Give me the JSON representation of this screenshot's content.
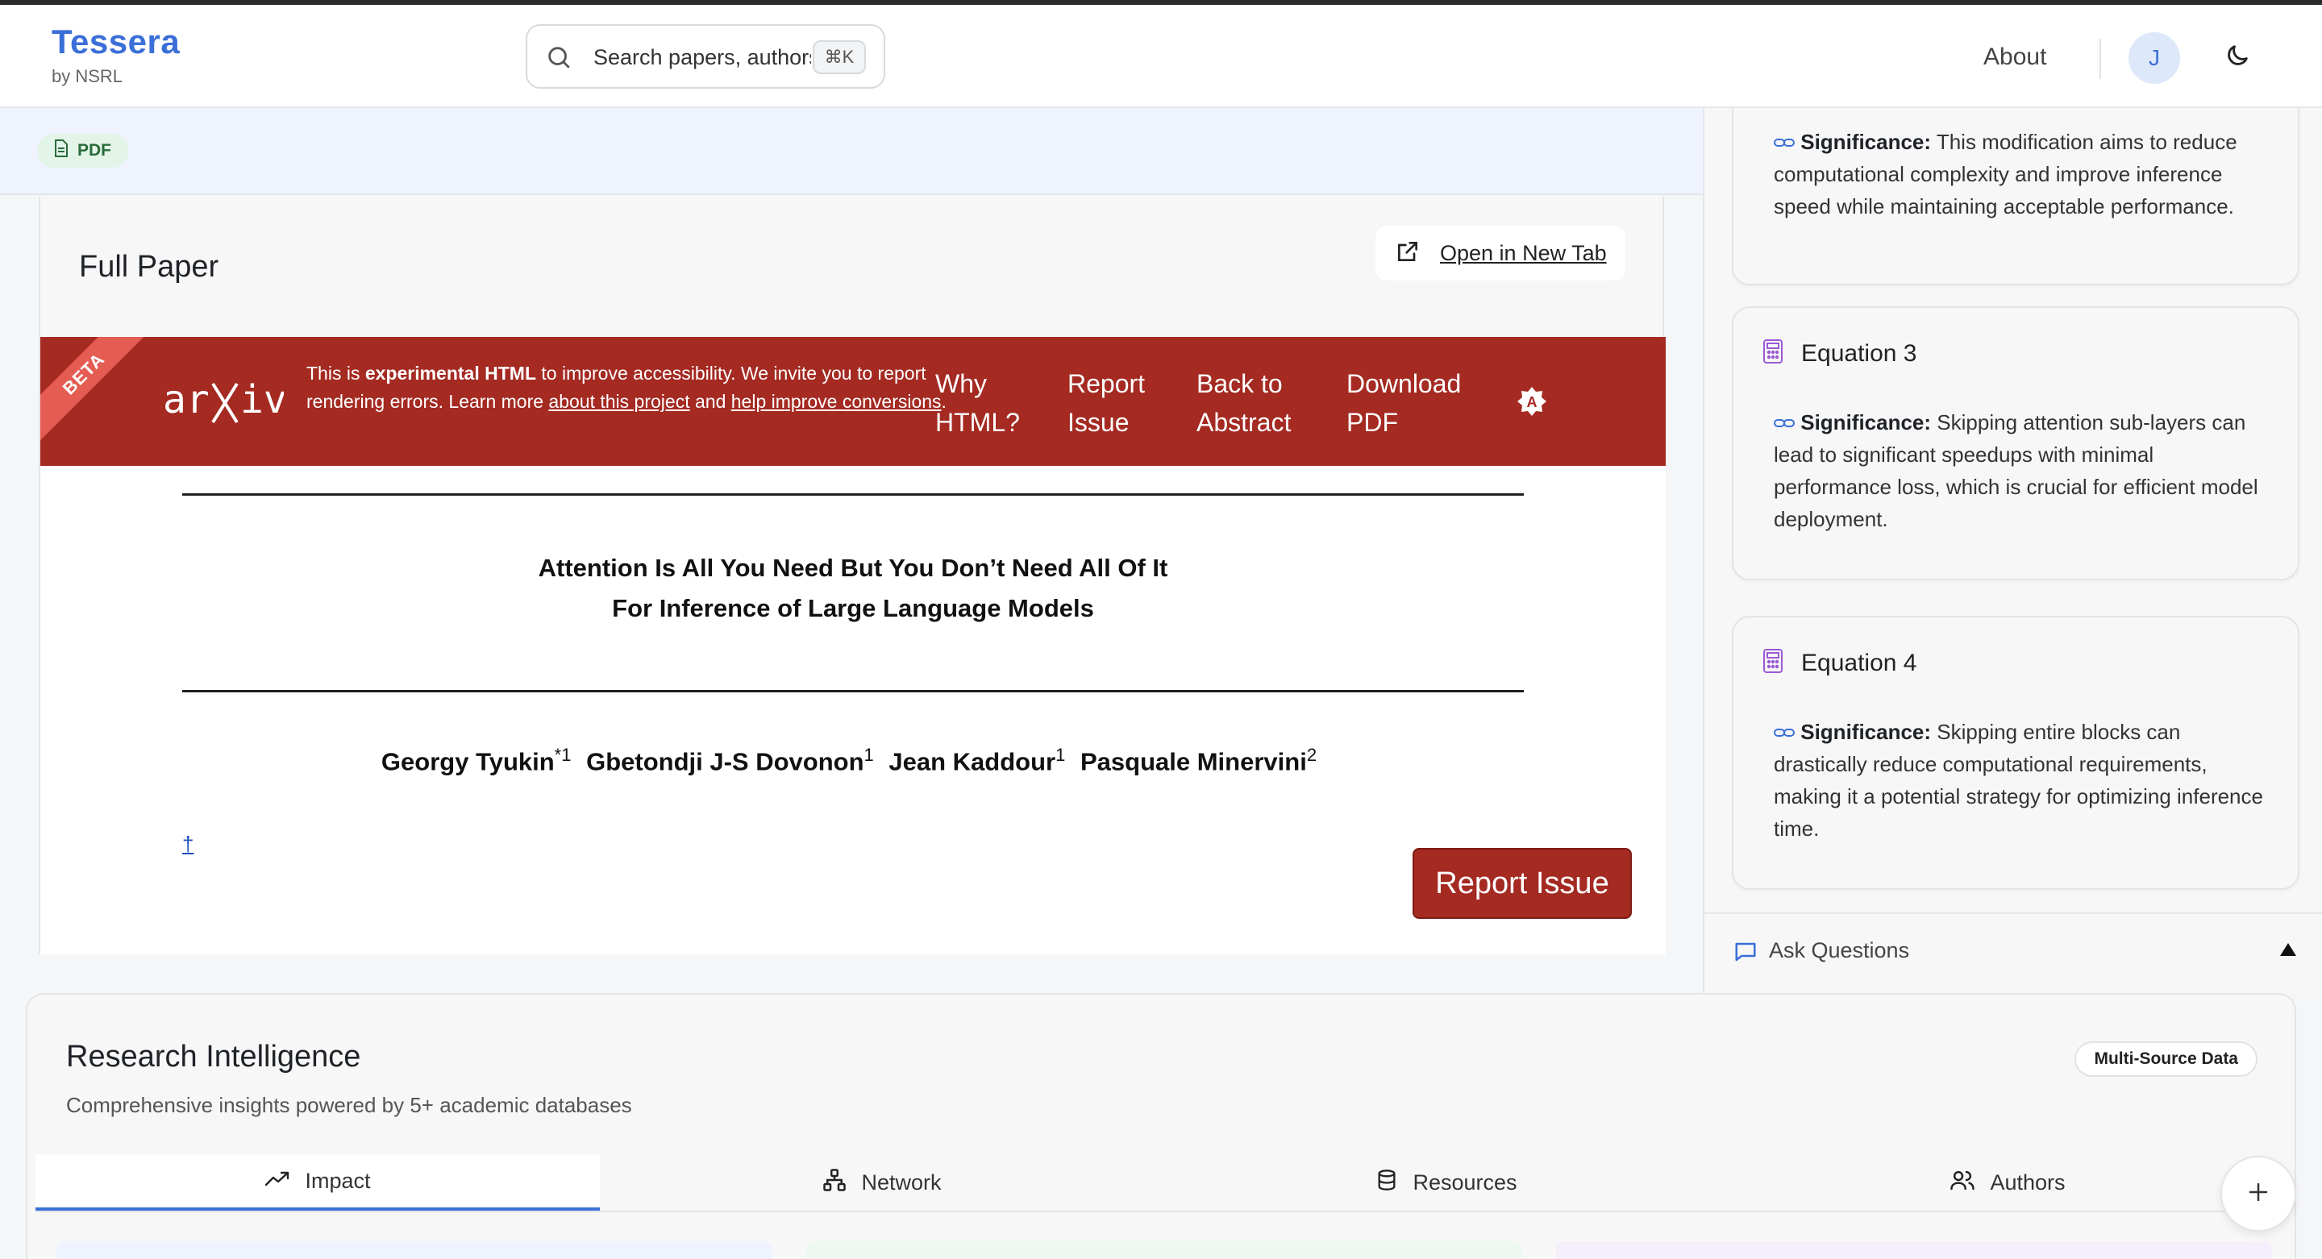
{
  "header": {
    "brand_title": "Tessera",
    "brand_sub": "by NSRL",
    "search_placeholder": "Search papers, authors...",
    "search_shortcut": "⌘K",
    "about_label": "About",
    "avatar_initial": "J"
  },
  "paper": {
    "format_badge": "PDF",
    "full_paper_title": "Full Paper",
    "open_new_tab_label": "Open in New Tab",
    "arxiv_banner": {
      "ribbon": "BETA",
      "logo_text": "arXiv",
      "notice_pre": "This is ",
      "notice_bold": "experimental HTML",
      "notice_mid": " to improve accessibility. We invite you to report rendering errors. Learn more ",
      "notice_link1": "about this project",
      "notice_and": " and ",
      "notice_link2": "help improve conversions",
      "notice_end": ".",
      "links": [
        "Why HTML?",
        "Report Issue",
        "Back to Abstract",
        "Download PDF"
      ]
    },
    "title_line1": "Attention Is All You Need But You Don’t Need All Of It",
    "title_line2": "For Inference of Large Language Models",
    "authors": [
      {
        "name": "Georgy Tyukin",
        "sup": "*1"
      },
      {
        "name": "Gbetondji J-S Dovonon",
        "sup": "1"
      },
      {
        "name": "Jean Kaddour",
        "sup": "1"
      },
      {
        "name": "Pasquale Minervini",
        "sup": "2"
      }
    ],
    "dagger": "†",
    "report_button": "Report Issue"
  },
  "equations": [
    {
      "title": "",
      "significance_label": "Significance:",
      "significance": "This modification aims to reduce computational complexity and improve inference speed while maintaining acceptable performance."
    },
    {
      "title": "Equation 3",
      "significance_label": "Significance:",
      "significance": "Skipping attention sub-layers can lead to significant speedups with minimal performance loss, which is crucial for efficient model deployment."
    },
    {
      "title": "Equation 4",
      "significance_label": "Significance:",
      "significance": "Skipping entire blocks can drastically reduce computational requirements, making it a potential strategy for optimizing inference time."
    }
  ],
  "ask_questions_label": "Ask Questions",
  "research": {
    "title": "Research Intelligence",
    "subtitle": "Comprehensive insights powered by 5+ academic databases",
    "badge": "Multi-Source Data",
    "tabs": [
      "Impact",
      "Network",
      "Resources",
      "Authors"
    ]
  },
  "colors": {
    "brand": "#3b6fd8",
    "arxiv_red": "#a42a22",
    "equation_icon": "#9b59d6"
  }
}
